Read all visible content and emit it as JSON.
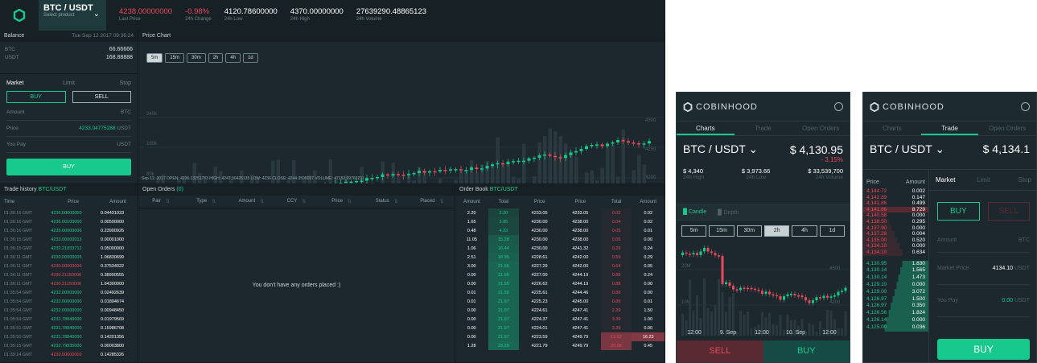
{
  "desktop": {
    "product": {
      "pair": "BTC / USDT",
      "sub": "Select product"
    },
    "stats": [
      {
        "value": "4238.00000000",
        "label": "Last Price",
        "cls": "red"
      },
      {
        "value": "-0.98%",
        "label": "24h Change",
        "cls": "red"
      },
      {
        "value": "4120.78600000",
        "label": "24h Low",
        "cls": ""
      },
      {
        "value": "4370.00000000",
        "label": "24h High",
        "cls": ""
      },
      {
        "value": "27639290.48865123",
        "label": "24h Volume",
        "cls": ""
      }
    ],
    "balance": {
      "title": "Balance",
      "date": "Tue Sep 12 2017 09:36:24",
      "rows": [
        {
          "c": "BTC",
          "v": "66.66666"
        },
        {
          "c": "USDT",
          "v": "168.88888"
        }
      ]
    },
    "order_form": {
      "tabs": [
        "Market",
        "Limit",
        "Stop"
      ],
      "buy": "BUY",
      "sell": "SELL",
      "amount_label": "Amount",
      "amount_unit": "BTC",
      "price_label": "Price",
      "price_value": "4233.04775288",
      "price_unit": "USDT",
      "pay_label": "You Pay",
      "pay_unit": "USDT",
      "submit": "BUY"
    },
    "price_chart": {
      "title": "Price Chart",
      "intervals": [
        "5m",
        "15m",
        "30m",
        "2h",
        "4h",
        "1d"
      ],
      "info": "Sep 12, 2017 OPEN: 4236.13251783 HIGH: 4247.30426135 LOW: 4236 CLOSE: 4244.3598097 VOLUME: 47182.09769231"
    },
    "trade_history": {
      "title": "Trade history",
      "pair": "BTC/USDT",
      "headers": [
        "Time",
        "Price",
        "Amount"
      ],
      "rows": [
        [
          "01:36:16 GMT",
          "4236.00000000",
          "0.04431033",
          "g"
        ],
        [
          "01:36:16 GMT",
          "4236.00100000",
          "0.00500000",
          "g"
        ],
        [
          "01:36:16 GMT",
          "4235.00000006",
          "0.23900926",
          "g"
        ],
        [
          "01:36:15 GMT",
          "4233.00000013",
          "0.00001000",
          "g"
        ],
        [
          "01:36:15 GMT",
          "4232.21833712",
          "0.05000000",
          "g"
        ],
        [
          "01:36:11 GMT",
          "4230.00000005",
          "1.06830699",
          "g"
        ],
        [
          "01:36:11 GMT",
          "4230.00000006",
          "0.37534022",
          "r"
        ],
        [
          "01:36:11 GMT",
          "4230.21150006",
          "0.38900555",
          "r"
        ],
        [
          "01:36:11 GMT",
          "4230.21150006",
          "1.64300000",
          "r"
        ],
        [
          "01:35:54 GMT",
          "4232.00000000",
          "0.02492639",
          "g"
        ],
        [
          "01:35:54 GMT",
          "4232.00000000",
          "0.01894674",
          "g"
        ],
        [
          "01:35:54 GMT",
          "4232.00000000",
          "0.00948450",
          "g"
        ],
        [
          "01:35:54 GMT",
          "4231.78840000",
          "0.01979569",
          "g"
        ],
        [
          "01:35:51 GMT",
          "4231.78840000",
          "0.15986708",
          "g"
        ],
        [
          "01:35:50 GMT",
          "4231.78840000",
          "0.14201356",
          "g"
        ],
        [
          "01:35:15 GMT",
          "4232.79835000",
          "0.00003800",
          "g"
        ],
        [
          "01:35:14 GMT",
          "4230.00000000",
          "0.14285326",
          "r"
        ]
      ]
    },
    "open_orders": {
      "title": "Open Orders",
      "count": "(0)",
      "headers": [
        "Pair",
        "Type",
        "Amount",
        "CCY",
        "Price",
        "Status",
        "Placed"
      ],
      "empty": "You don't have any orders placed :)"
    },
    "order_book": {
      "title": "Order Book",
      "pair": "BTC/USDT",
      "headers": [
        "Amount",
        "Total",
        "Price",
        "Price",
        "Total",
        "Amount"
      ],
      "rows": [
        [
          "2.20",
          "2.20",
          "4233.05",
          "4233.05",
          "0.02",
          "0.02"
        ],
        [
          "1.65",
          "3.85",
          "4230.00",
          "4238.00",
          "0.04",
          "0.02"
        ],
        [
          "0.48",
          "4.33",
          "4230.00",
          "4238.00",
          "0.05",
          "0.01"
        ],
        [
          "11.05",
          "15.38",
          "4230.00",
          "4238.00",
          "0.05",
          "0.00"
        ],
        [
          "1.06",
          "16.44",
          "4230.00",
          "4241.32",
          "0.29",
          "0.24"
        ],
        [
          "2.51",
          "18.95",
          "4228.61",
          "4242.00",
          "0.59",
          "0.29"
        ],
        [
          "3.00",
          "21.95",
          "4227.29",
          "4242.00",
          "0.64",
          "0.05"
        ],
        [
          "0.00",
          "21.95",
          "4227.00",
          "4244.19",
          "0.88",
          "0.24"
        ],
        [
          "0.00",
          "21.95",
          "4226.62",
          "4244.19",
          "0.88",
          "0.00"
        ],
        [
          "0.01",
          "21.96",
          "4225.61",
          "4244.46",
          "0.88",
          "0.00"
        ],
        [
          "0.01",
          "21.97",
          "4225.23",
          "4245.00",
          "0.89",
          "0.01"
        ],
        [
          "0.00",
          "21.97",
          "4224.61",
          "4247.41",
          "2.39",
          "1.50"
        ],
        [
          "0.00",
          "21.97",
          "4224.37",
          "4247.41",
          "3.39",
          "1.00"
        ],
        [
          "0.00",
          "21.97",
          "4224.01",
          "4247.41",
          "3.39",
          "0.00"
        ],
        [
          "0.00",
          "21.97",
          "4223.59",
          "4249.79",
          "19.62",
          "16.23"
        ],
        [
          "1.28",
          "23.25",
          "4221.79",
          "4249.79",
          "20.06",
          "0.45"
        ]
      ]
    }
  },
  "mobile1": {
    "brand": "COBINHOOD",
    "tabs": [
      "Charts",
      "Trade",
      "Open Orders"
    ],
    "pair": "BTC / USDT",
    "price": "$ 4,130.95",
    "change": "- 3.15%",
    "stats": [
      {
        "v": "$ 4,340",
        "l": "24h High"
      },
      {
        "v": "$ 3,973.66",
        "l": "24h Low"
      },
      {
        "v": "$ 33,539,700",
        "l": "24h Volume"
      }
    ],
    "chart_tabs": [
      "Candle",
      "Depth"
    ],
    "intervals": [
      "5m",
      "15m",
      "30m",
      "2h",
      "4h",
      "1d"
    ],
    "axis": [
      "12:00",
      "9. Sep",
      "12:00",
      "10. Sep",
      "12:00"
    ],
    "y": [
      "4500",
      "4200"
    ],
    "vol": [
      "20M",
      "10M"
    ],
    "sell": "SELL",
    "buy": "BUY"
  },
  "mobile2": {
    "brand": "COBINHOOD",
    "tabs": [
      "Charts",
      "Trade",
      "Open Orders"
    ],
    "pair": "BTC / USDT",
    "price": "$ 4,134.1",
    "book_headers": [
      "Price",
      "Amount"
    ],
    "asks": [
      [
        "4,144.72",
        "0.002"
      ],
      [
        "4,142.89",
        "0.147"
      ],
      [
        "4,141.86",
        "0.499"
      ],
      [
        "4,141.86",
        "8.729"
      ],
      [
        "4,140.58",
        "0.000"
      ],
      [
        "4,138.50",
        "0.295"
      ],
      [
        "4,137.90",
        "0.000"
      ],
      [
        "4,137.28",
        "0.004"
      ],
      [
        "4,135.00",
        "0.520"
      ],
      [
        "4,134.10",
        "0.000"
      ],
      [
        "4,134.10",
        "0.634"
      ]
    ],
    "bids": [
      [
        "4,130.95",
        "1.830"
      ],
      [
        "4,130.14",
        "1.565"
      ],
      [
        "4,130.14",
        "1.473"
      ],
      [
        "4,129.10",
        "0.000"
      ],
      [
        "4,129.00",
        "3.072"
      ],
      [
        "4,126.97",
        "1.500"
      ],
      [
        "4,126.97",
        "0.350"
      ],
      [
        "4,126.56",
        "1.824"
      ],
      [
        "4,126.14",
        "0.000"
      ],
      [
        "4,125.00",
        "0.036"
      ]
    ],
    "form_tabs": [
      "Market",
      "Limit",
      "Stop"
    ],
    "buy": "BUY",
    "sell": "SELL",
    "amount_label": "Amount",
    "amount_unit": "BTC",
    "mprice_label": "Market Price",
    "mprice_value": "4134.10",
    "mprice_unit": "USDT",
    "pay_label": "You Pay",
    "pay_value": "0.00",
    "pay_unit": "USDT",
    "submit": "BUY"
  }
}
